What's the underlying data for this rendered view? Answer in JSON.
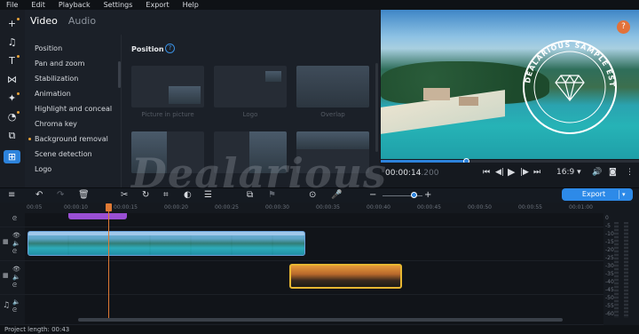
{
  "menu": [
    "File",
    "Edit",
    "Playback",
    "Settings",
    "Export",
    "Help"
  ],
  "panel": {
    "tabs": [
      "Video",
      "Audio"
    ],
    "active_tab": "Video",
    "list": [
      "Position",
      "Pan and zoom",
      "Stabilization",
      "Animation",
      "Highlight and conceal",
      "Chroma key",
      "Background removal",
      "Scene detection",
      "Logo"
    ],
    "section_title": "Position",
    "help_glyph": "?",
    "presets": [
      "Picture in picture",
      "Logo",
      "Overlap"
    ]
  },
  "preview": {
    "watermark_line1": "DEALARIOUS SAMPLE ESTS",
    "help_glyph": "?",
    "scrub_progress": 0.33
  },
  "player": {
    "timecode_main": "00:00:14",
    "timecode_ms": ".200",
    "aspect": "16:9",
    "aspect_arrow": "▾"
  },
  "timeline": {
    "export_label": "Export",
    "ruler": [
      "00:05",
      "00:00:10",
      "00:00:15",
      "00:00:20",
      "00:00:25",
      "00:00:30",
      "00:00:35",
      "00:00:40",
      "00:00:45",
      "00:00:50",
      "00:00:55",
      "00:01:00"
    ],
    "zoom_level": 0.78
  },
  "meter": [
    "0",
    "-5",
    "-10",
    "-15",
    "-20",
    "-25",
    "-30",
    "-35",
    "-40",
    "-45",
    "-50",
    "-55",
    "-60"
  ],
  "status": "Project length: 00:43",
  "watermark": "Dealarious",
  "colors": {
    "accent": "#2d83dc",
    "playhead": "#e07a34",
    "title_clip": "#9a4fd4",
    "selected_clip": "#e8b732"
  }
}
